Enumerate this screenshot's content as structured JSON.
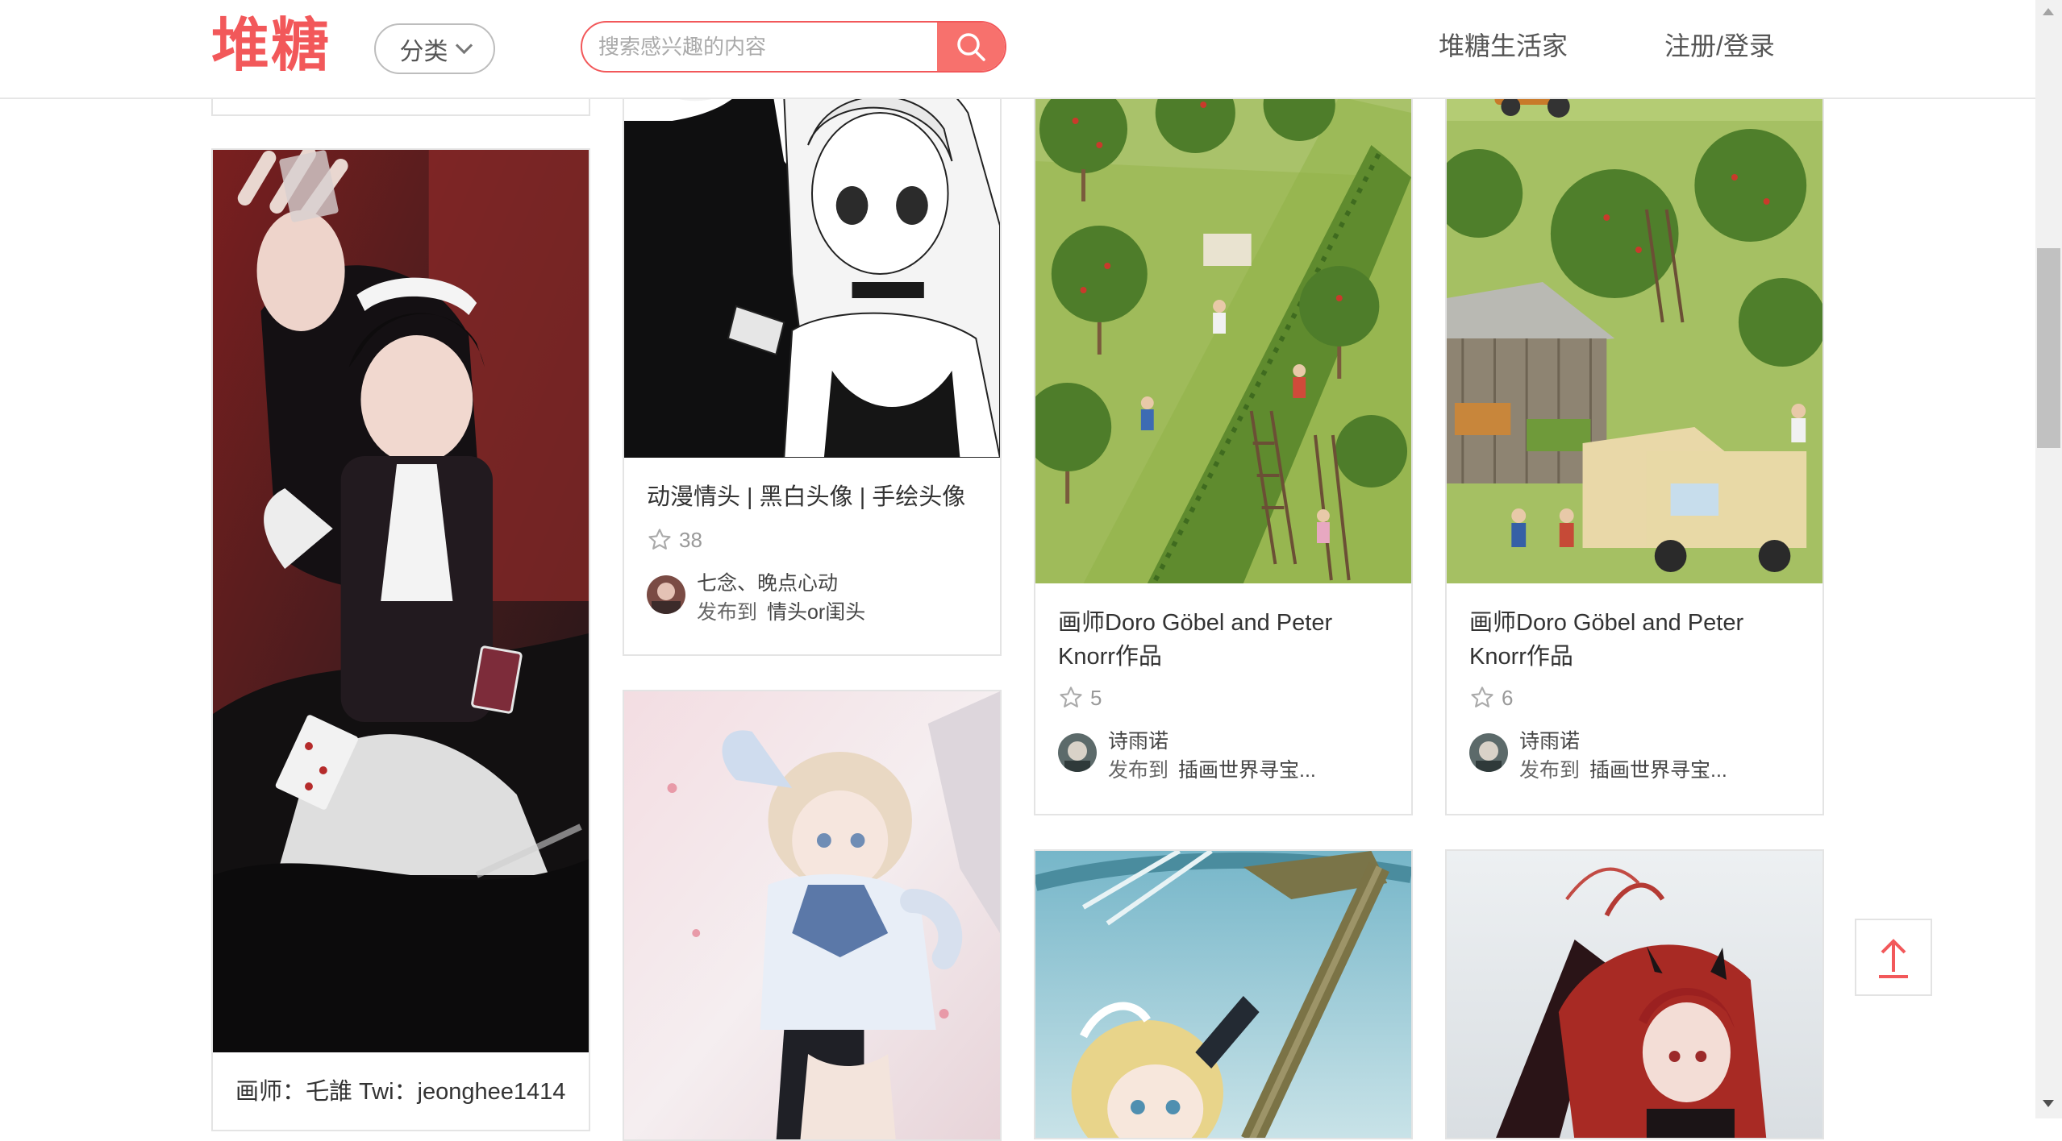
{
  "header": {
    "logo": "堆糖",
    "category_label": "分类",
    "search_placeholder": "搜索感兴趣的内容",
    "nav_life": "堆糖生活家",
    "nav_login": "注册/登录"
  },
  "colors": {
    "brand": "#f2585a",
    "search_button": "#f7716d",
    "border": "#e4e4e4"
  },
  "cards": [
    {
      "id": "maid",
      "title": "画师：乇誰 Twi：jeonghee1414",
      "image_subject": "anime maid girl throwing playing cards"
    },
    {
      "id": "couple",
      "title": "动漫情头 | 黑白头像 | 手绘头像",
      "stars": "38",
      "user": "七念、晚点心动",
      "publish_label": "发布到",
      "board": "情头or闺头",
      "image_subject": "black and white anime couple avatar"
    },
    {
      "id": "orchard1",
      "title": "画师Doro Göbel and Peter Knorr作品",
      "stars": "5",
      "user": "诗雨诺",
      "publish_label": "发布到",
      "board": "插画世界寻宝...",
      "image_subject": "orchard illustration with ladders"
    },
    {
      "id": "orchard2",
      "title": "画师Doro Göbel and Peter Knorr作品",
      "stars": "6",
      "user": "诗雨诺",
      "publish_label": "发布到",
      "board": "插画世界寻宝...",
      "image_subject": "farm market illustration with truck"
    },
    {
      "id": "pastel",
      "image_subject": "pastel anime girl in sailor uniform"
    },
    {
      "id": "guitar",
      "image_subject": "blonde anime girl with guitar"
    },
    {
      "id": "redhair",
      "image_subject": "red haired anime girl with horns"
    }
  ],
  "icons": {
    "search": "search-icon",
    "star": "star-icon",
    "back_to_top": "arrow-up-icon",
    "dropdown": "chevron-down-icon"
  }
}
